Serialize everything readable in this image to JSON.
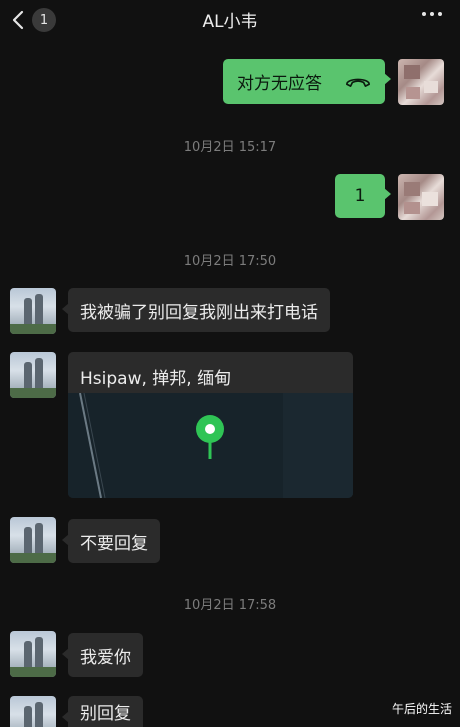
{
  "header": {
    "back_badge": "1",
    "title": "AL小韦"
  },
  "messages": {
    "outgoing_call": "对方无应答",
    "outgoing_text": "1",
    "time_1": "10月2日 15:17",
    "time_2": "10月2日 17:50",
    "incoming_1": "我被骗了别回复我刚出来打电话",
    "location_title": "Hsipaw, 掸邦, 缅甸",
    "incoming_2": "不要回复",
    "time_3": "10月2日 17:58",
    "incoming_3": "我爱你",
    "incoming_4": "别回复"
  },
  "watermark": "午后的生活",
  "colors": {
    "background": "#111111",
    "outgoing_bubble": "#5ac46e",
    "incoming_bubble": "#2b2b2b",
    "map_pin": "#2fc455"
  },
  "icons": [
    "back-chevron-icon",
    "more-dots-icon",
    "hangup-phone-icon",
    "map-pin-icon"
  ]
}
